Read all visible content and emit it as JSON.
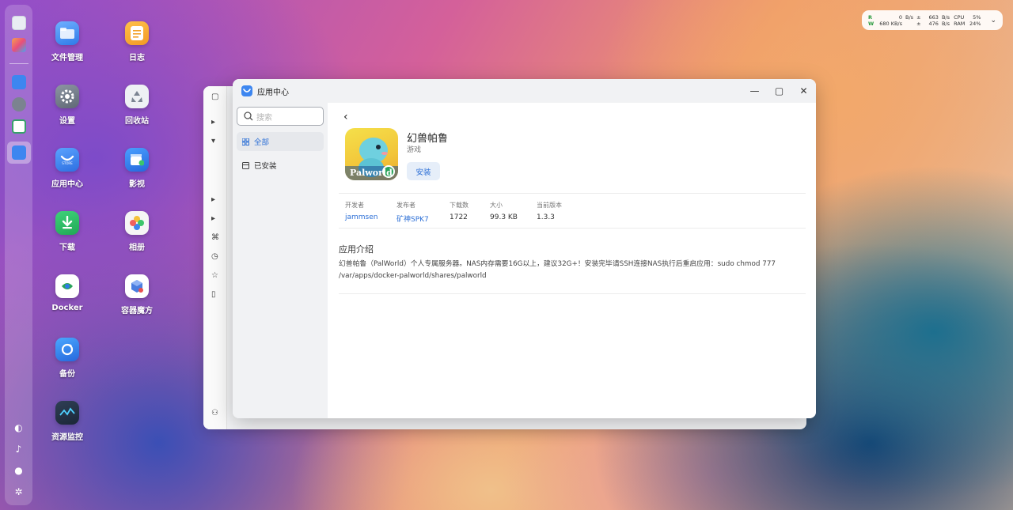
{
  "desktop": {
    "icons": [
      {
        "label": "文件管理"
      },
      {
        "label": "日志"
      },
      {
        "label": "设置"
      },
      {
        "label": "回收站"
      },
      {
        "label": "应用中心"
      },
      {
        "label": "影视"
      },
      {
        "label": "下载"
      },
      {
        "label": "相册"
      },
      {
        "label": "Docker"
      },
      {
        "label": "容器魔方"
      },
      {
        "label": "备份"
      },
      {
        "label": "资源监控"
      }
    ]
  },
  "netwidget": {
    "r_label": "R",
    "w_label": "W",
    "r_speed": "0",
    "r_unit": "B/s",
    "w_speed": "680 KB/s",
    "up_a": "663",
    "up_a_unit": "B/s",
    "up_b": "476",
    "up_b_unit": "B/s",
    "cpu_label": "CPU",
    "ram_label": "RAM",
    "cpu_val": "5%",
    "ram_val": "24%"
  },
  "window": {
    "title": "应用中心",
    "search_placeholder": "搜索",
    "nav": [
      {
        "label": "全部"
      },
      {
        "label": "已安装"
      }
    ],
    "app": {
      "name": "幻兽帕鲁",
      "category": "游戏",
      "install_label": "安装",
      "icon_text": "Palworld"
    },
    "meta": [
      {
        "key": "开发者",
        "value": "jammsen"
      },
      {
        "key": "发布者",
        "value": "矿神SPK7"
      },
      {
        "key": "下载数",
        "value": "1722"
      },
      {
        "key": "大小",
        "value": "99.3 KB"
      },
      {
        "key": "当前版本",
        "value": "1.3.3"
      }
    ],
    "intro_title": "应用介绍",
    "intro_text": "幻兽帕鲁（PalWorld）个人专属服务器。NAS内存需要16G以上，建议32G+！安装完毕请SSH连接NAS执行后重启应用：sudo chmod 777 /var/apps/docker-palworld/shares/palworld"
  },
  "colors": {
    "accent": "#2c6fd6",
    "install_bg": "#e6eef9"
  }
}
